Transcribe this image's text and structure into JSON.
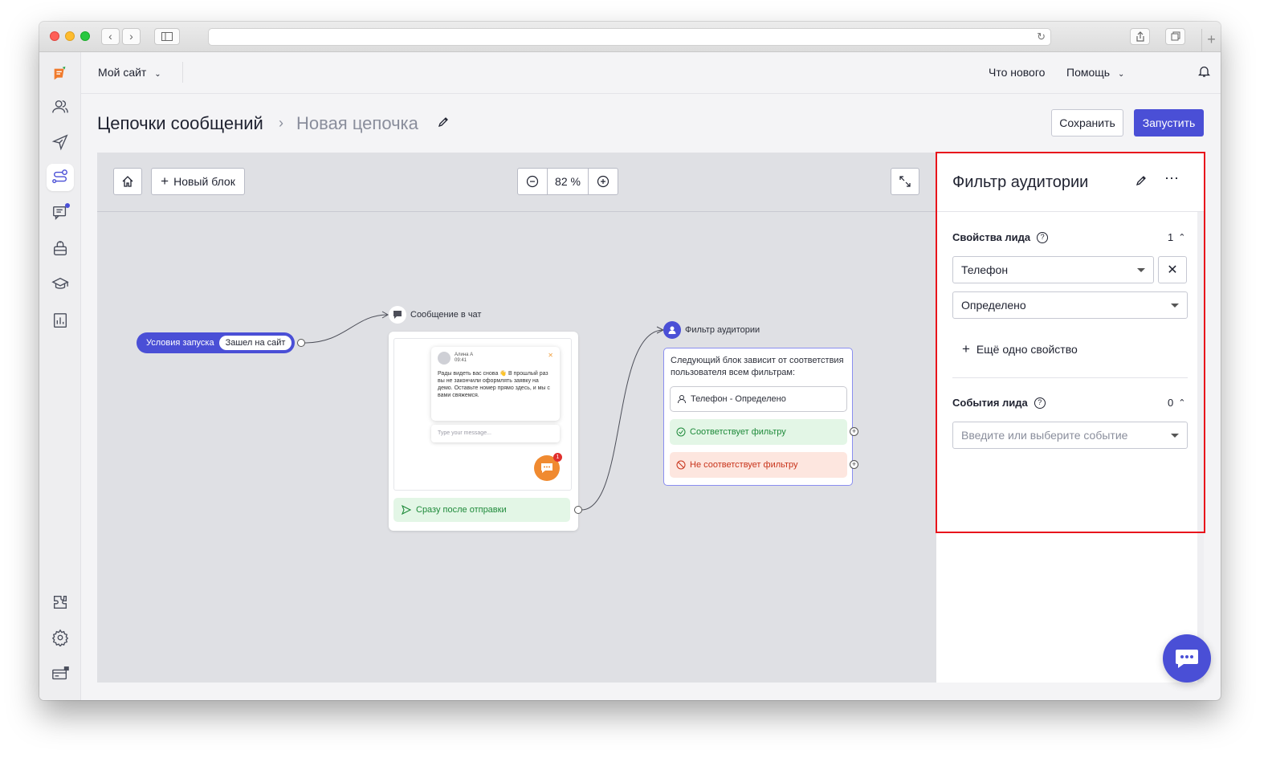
{
  "browser": {
    "address": ""
  },
  "topbar": {
    "site_select": "Мой сайт",
    "whats_new": "Что нового",
    "help": "Помощь"
  },
  "breadcrumb": {
    "parent": "Цепочки сообщений",
    "current": "Новая цепочка"
  },
  "actions": {
    "save": "Сохранить",
    "run": "Запустить"
  },
  "canvas": {
    "new_block": "Новый блок",
    "zoom_level": "82 %"
  },
  "flow": {
    "start": {
      "label": "Условия запуска",
      "badge": "Зашел на сайт"
    },
    "message_block": {
      "title": "Сообщение в чат",
      "preview_name": "Алина А",
      "preview_time": "09:41",
      "preview_text": "Рады видеть вас снова 👋 В прошлый раз вы не закончили оформлять заявку на демо. Оставьте номер прямо здесь, и мы с вами свяжемся.",
      "input_placeholder": "Type your message...",
      "unread_count": "1",
      "trigger": "Сразу после отправки"
    },
    "filter_block": {
      "title": "Фильтр аудитории",
      "description": "Следующий блок зависит от соответствия пользователя всем фильтрам:",
      "condition": "Телефон - Определено",
      "match": "Соответствует фильтру",
      "no_match": "Не соответствует фильтру"
    }
  },
  "panel": {
    "title": "Фильтр аудитории",
    "lead_props": {
      "title": "Свойства лида",
      "count": "1",
      "property": "Телефон",
      "operator": "Определено",
      "add_label": "Ещё одно свойство"
    },
    "lead_events": {
      "title": "События лида",
      "count": "0",
      "placeholder": "Введите или выберите событие"
    }
  },
  "colors": {
    "accent": "#4a4fd6",
    "success": "#1e8a3a",
    "danger": "#c8331a",
    "highlight": "#e8141c"
  }
}
